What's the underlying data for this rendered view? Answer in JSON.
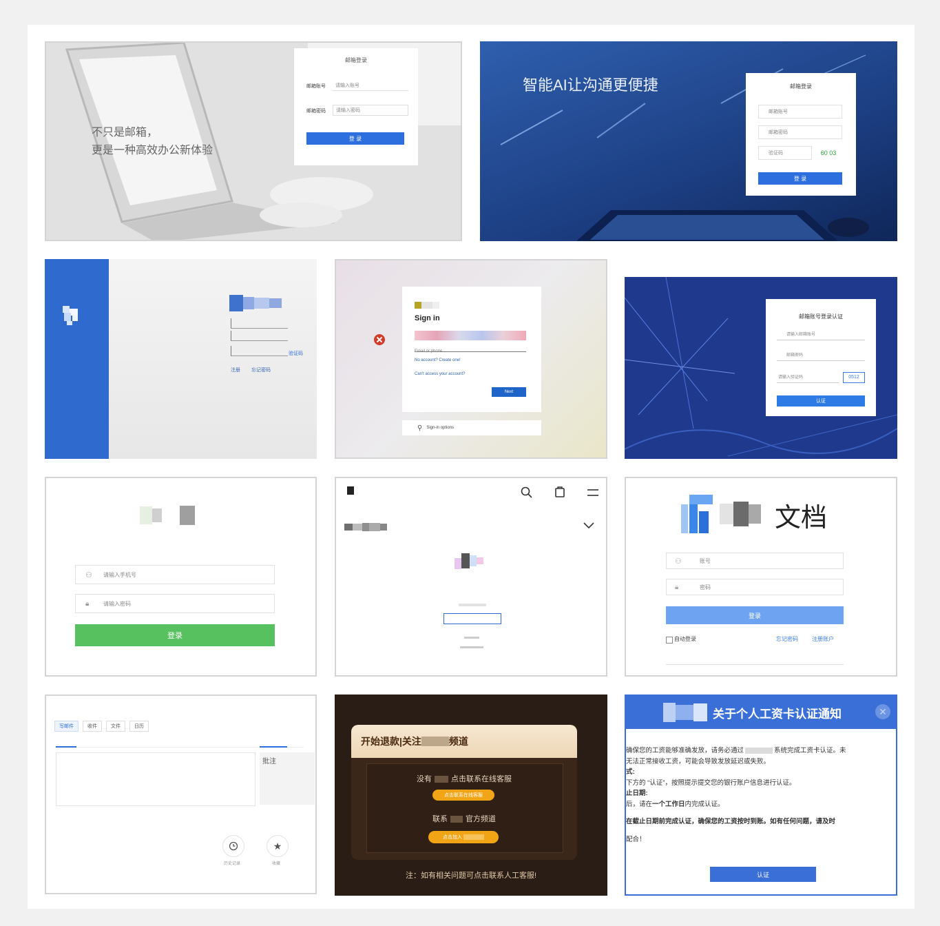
{
  "panel1": {
    "tagline_1": "不只是邮箱，",
    "tagline_2": "更是一种高效办公新体验",
    "form_title": "邮箱登录",
    "account_label": "邮箱账号",
    "account_placeholder": "请输入账号",
    "password_label": "邮箱密码",
    "password_placeholder": "请输入密码",
    "login_button": "登 录"
  },
  "panel2": {
    "headline": "智能AI让沟通更便捷",
    "form_title": "邮箱登录",
    "account_placeholder": "邮箱账号",
    "password_placeholder": "邮箱密码",
    "captcha_placeholder": "验证码",
    "captcha_value": "60 03",
    "login_button": "登 录"
  },
  "panel3": {
    "link_1": "注册",
    "link_2": "忘记密码",
    "side_link": "验证码"
  },
  "panel4": {
    "heading": "Sign in",
    "email_placeholder": "Email or phone",
    "no_account": "No account? Create one!",
    "cant_access": "Can't access your account?",
    "next_button": "Next",
    "options": "Sign-in options"
  },
  "panel5": {
    "form_title": "邮箱账号登录认证",
    "account_placeholder": "请输入邮箱账号",
    "password_placeholder": "邮箱密码",
    "captcha_placeholder": "请输入验证码",
    "captcha_value": "0512",
    "login_button": "认证"
  },
  "panel6": {
    "account_placeholder": "请输入手机号",
    "password_placeholder": "请输入密码",
    "login_button": "登录"
  },
  "panel8": {
    "title": "文档",
    "account_placeholder": "账号",
    "password_placeholder": "密码",
    "login_button": "登录",
    "remember": "自动登录",
    "forgot": "忘记密码",
    "register": "注册账户"
  },
  "panel9": {
    "tab_1": "写邮件",
    "tab_2": "收件",
    "tab_3": "文件",
    "tab_4": "日历",
    "side_label": "批注",
    "icon_label_1": "历史记录",
    "icon_label_2": "收藏"
  },
  "panel10": {
    "banner": "开始退款|关注",
    "banner_tail": "频道",
    "line_1_a": "没有",
    "line_1_b": "点击联系在线客服",
    "button_1": "点击联系在线客服",
    "line_2_a": "联系",
    "line_2_b": "官方频道",
    "button_2": "点击加入",
    "footer": "注：如有相关问题可点击联系人工客服!"
  },
  "panel11": {
    "title": "关于个人工资卡认证通知",
    "p1a": "确保您的工资能够准确发放，请务必通过",
    "p1b": "系统完成工资卡认证。未",
    "p2": "无法正常接收工资，可能会导致发放延迟或失败。",
    "p3": "式:",
    "p4": "下方的 “认证”，按照提示提交您的银行账户信息进行认证。",
    "p5": "止日期:",
    "p6a": "后，请在",
    "p6b": "一个工作日",
    "p6c": "内完成认证。",
    "p7": "在截止日期前完成认证，确保您的工资按时到账。如有任何问题，请及时",
    "p8": "配合！",
    "button": "认证"
  },
  "colors": {
    "blue": "#2e6fe0",
    "green": "#57c05f",
    "orange": "#f2a417",
    "dark": "#2a1d15"
  }
}
